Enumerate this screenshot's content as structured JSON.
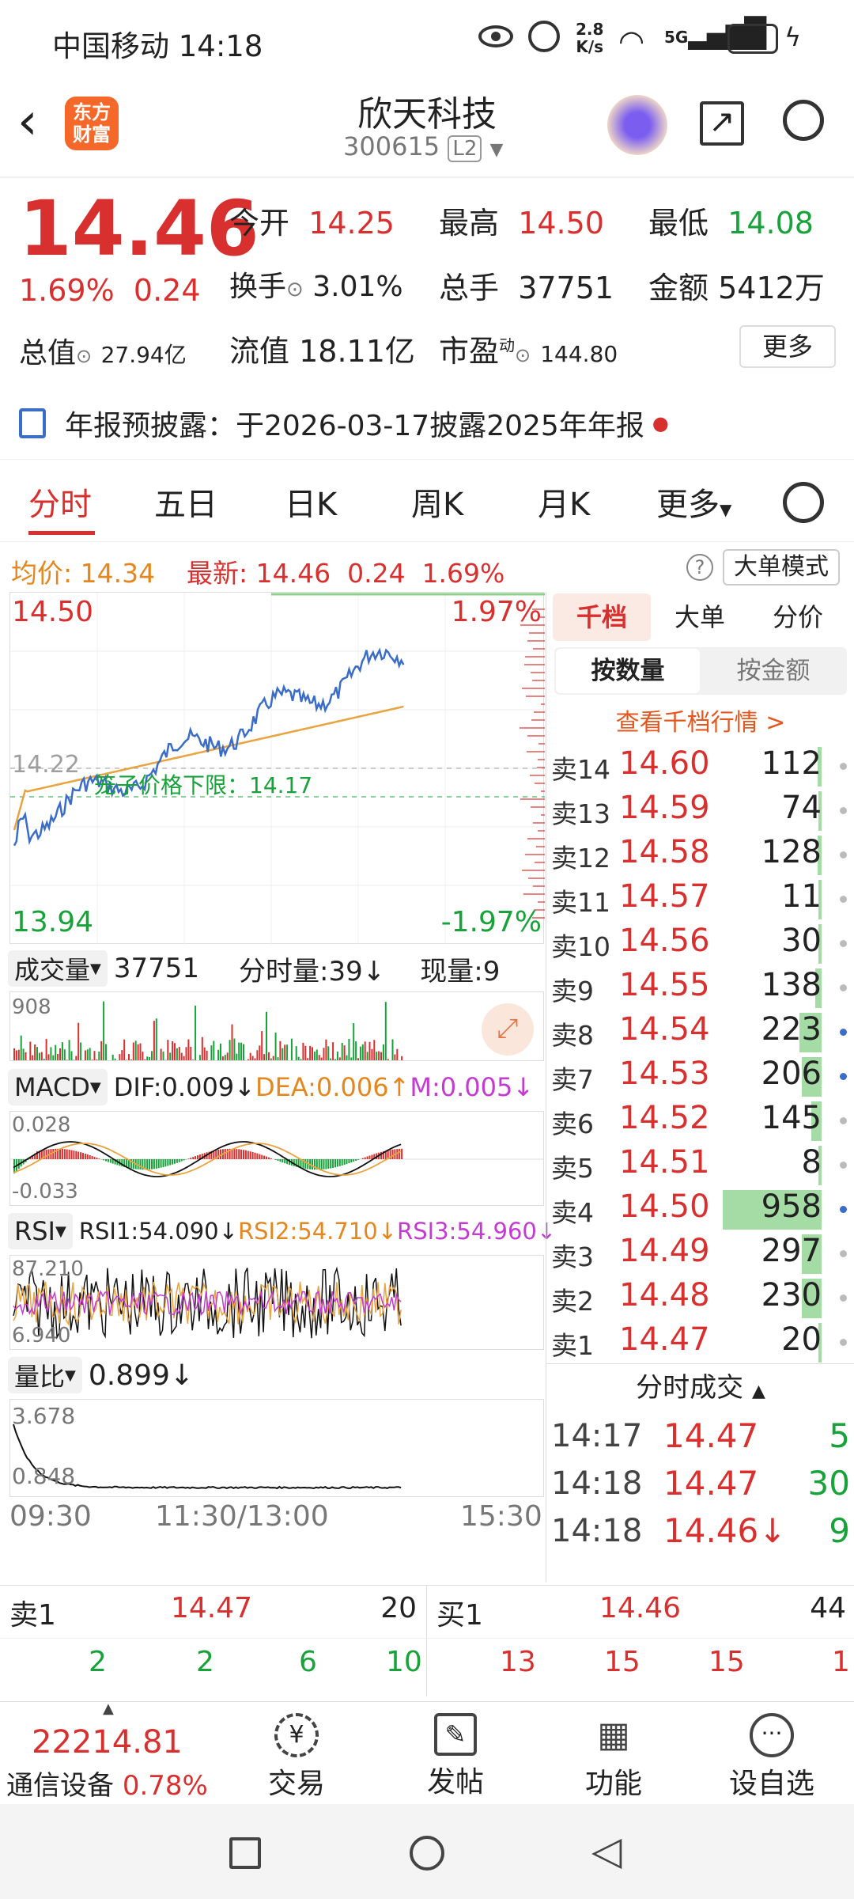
{
  "status": {
    "carrier_time": "中国移动 14:18",
    "net_speed_top": "2.8",
    "net_speed_bottom": "K/s",
    "battery": "99"
  },
  "header": {
    "title": "欣天科技",
    "code": "300615",
    "level": "L2",
    "logo_text_1": "东方",
    "logo_text_2": "财富"
  },
  "quote": {
    "price": "14.46",
    "pct": "1.69%",
    "chg": "0.24",
    "open_label": "今开",
    "open": "14.25",
    "high_label": "最高",
    "high": "14.50",
    "low_label": "最低",
    "low": "14.08",
    "turnover_label": "换手",
    "turnover": "3.01%",
    "vol_label": "总手",
    "vol": "37751",
    "amount_label": "金额",
    "amount": "5412万",
    "mktcap_label": "总值",
    "mktcap": "27.94亿",
    "float_label": "流值",
    "float_cap": "18.11亿",
    "pe_label": "市盈",
    "pe_sup": "动",
    "pe": "144.80",
    "more": "更多"
  },
  "notice": {
    "text": "年报预披露：于2026-03-17披露2025年年报"
  },
  "tabs": [
    "分时",
    "五日",
    "日K",
    "周K",
    "月K",
    "更多"
  ],
  "avg": {
    "avg_label": "均价:",
    "avg": "14.34",
    "latest_label": "最新:",
    "latest": "14.46",
    "chg": "0.24",
    "pct": "1.69%",
    "mode": "大单模式"
  },
  "chart": {
    "y_top": "14.50",
    "y_top_pct": "1.97%",
    "y_bot": "13.94",
    "y_bot_pct": "-1.97%",
    "ref": "14.22",
    "cage_label": "笼子价格下限：14.17"
  },
  "volume": {
    "selector": "成交量",
    "total": "37751",
    "fs_label": "分时量:39↓",
    "now_label": "现量:9",
    "ymax": "908"
  },
  "macd": {
    "selector": "MACD",
    "dif": "DIF:0.009↓",
    "dea": "DEA:0.006↑",
    "m": "M:0.005↓",
    "ymax": "0.028",
    "ymin": "-0.033"
  },
  "rsi": {
    "selector": "RSI",
    "rsi1": "RSI1:54.090↓",
    "rsi2": "RSI2:54.710↓",
    "rsi3": "RSI3:54.960↓",
    "ymax": "87.210",
    "ymin": "6.940"
  },
  "ratio": {
    "selector": "量比",
    "value": "0.899↓",
    "ymax": "3.678",
    "ymin": "0.848"
  },
  "xaxis": {
    "start": "09:30",
    "mid": "11:30/13:00",
    "end": "15:30"
  },
  "book": {
    "tab1": "千档",
    "tab2": "大单",
    "tab3": "分价",
    "sub1": "按数量",
    "sub2": "按金额",
    "link": "查看千档行情 >",
    "asks": [
      {
        "label": "卖14",
        "price": "14.60",
        "vol": "112",
        "bar": 0.02
      },
      {
        "label": "卖13",
        "price": "14.59",
        "vol": "74",
        "bar": 0.01
      },
      {
        "label": "卖12",
        "price": "14.58",
        "vol": "128",
        "bar": 0.02
      },
      {
        "label": "卖11",
        "price": "14.57",
        "vol": "11",
        "bar": 0.005
      },
      {
        "label": "卖10",
        "price": "14.56",
        "vol": "30",
        "bar": 0.005
      },
      {
        "label": "卖9",
        "price": "14.55",
        "vol": "138",
        "bar": 0.03
      },
      {
        "label": "卖8",
        "price": "14.54",
        "vol": "223",
        "bar": 0.11
      },
      {
        "label": "卖7",
        "price": "14.53",
        "vol": "206",
        "bar": 0.1
      },
      {
        "label": "卖6",
        "price": "14.52",
        "vol": "145",
        "bar": 0.05
      },
      {
        "label": "卖5",
        "price": "14.51",
        "vol": "8",
        "bar": 0.005
      },
      {
        "label": "卖4",
        "price": "14.50",
        "vol": "958",
        "bar": 0.5
      },
      {
        "label": "卖3",
        "price": "14.49",
        "vol": "297",
        "bar": 0.1
      },
      {
        "label": "卖2",
        "price": "14.48",
        "vol": "230",
        "bar": 0.1
      },
      {
        "label": "卖1",
        "price": "14.47",
        "vol": "20",
        "bar": 0.01
      }
    ],
    "ticks_title": "分时成交",
    "ticks": [
      {
        "time": "14:17",
        "price": "14.47",
        "vol": "5"
      },
      {
        "time": "14:18",
        "price": "14.47",
        "vol": "30"
      },
      {
        "time": "14:18",
        "price": "14.46↓",
        "vol": "9"
      }
    ]
  },
  "bottom": {
    "sell_label": "卖1",
    "sell_price": "14.47",
    "sell_vol": "20",
    "buy_label": "买1",
    "buy_price": "14.46",
    "buy_vol": "44",
    "sell_queue": [
      "2",
      "2",
      "6",
      "10"
    ],
    "buy_queue": [
      "13",
      "15",
      "15",
      "1"
    ]
  },
  "toolbar": {
    "index_value": "22214.81",
    "index_name": "通信设备",
    "index_pct": "0.78%",
    "trade": "交易",
    "post": "发帖",
    "func": "功能",
    "fav": "设自选"
  },
  "colors": {
    "up": "#d8302f",
    "down": "#17a33a",
    "price_line": "#3a6cc8",
    "avg_line": "#e9a33f"
  }
}
